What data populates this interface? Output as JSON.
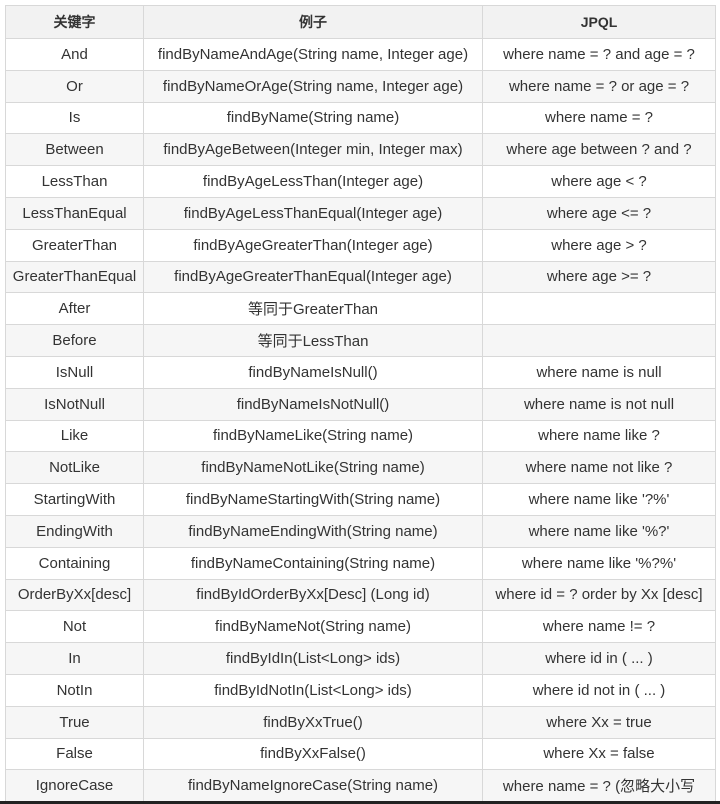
{
  "headers": [
    "关键字",
    "例子",
    "JPQL"
  ],
  "rows": [
    [
      "And",
      "findByNameAndAge(String name, Integer age)",
      "where name = ? and age = ?"
    ],
    [
      "Or",
      "findByNameOrAge(String name, Integer age)",
      "where name = ? or age = ?"
    ],
    [
      "Is",
      "findByName(String name)",
      "where name = ?"
    ],
    [
      "Between",
      "findByAgeBetween(Integer min, Integer max)",
      "where age between ? and ?"
    ],
    [
      "LessThan",
      "findByAgeLessThan(Integer age)",
      "where age < ?"
    ],
    [
      "LessThanEqual",
      "findByAgeLessThanEqual(Integer age)",
      "where age <= ?"
    ],
    [
      "GreaterThan",
      "findByAgeGreaterThan(Integer age)",
      "where age > ?"
    ],
    [
      "GreaterThanEqual",
      "findByAgeGreaterThanEqual(Integer age)",
      "where age >= ?"
    ],
    [
      "After",
      "等同于GreaterThan",
      ""
    ],
    [
      "Before",
      "等同于LessThan",
      ""
    ],
    [
      "IsNull",
      "findByNameIsNull()",
      "where name is null"
    ],
    [
      "IsNotNull",
      "findByNameIsNotNull()",
      "where name is not null"
    ],
    [
      "Like",
      "findByNameLike(String name)",
      "where name like ?"
    ],
    [
      "NotLike",
      "findByNameNotLike(String name)",
      "where name not like ?"
    ],
    [
      "StartingWith",
      "findByNameStartingWith(String name)",
      "where name like '?%'"
    ],
    [
      "EndingWith",
      "findByNameEndingWith(String name)",
      "where name like '%?'"
    ],
    [
      "Containing",
      "findByNameContaining(String name)",
      "where name like '%?%'"
    ],
    [
      "OrderByXx[desc]",
      "findByIdOrderByXx[Desc] (Long id)",
      "where id = ? order by Xx [desc]"
    ],
    [
      "Not",
      "findByNameNot(String name)",
      "where name != ?"
    ],
    [
      "In",
      "findByIdIn(List<Long> ids)",
      "where id in ( ... )"
    ],
    [
      "NotIn",
      "findByIdNotIn(List<Long> ids)",
      "where id not in ( ... )"
    ],
    [
      "True",
      "findByXxTrue()",
      "where Xx = true"
    ],
    [
      "False",
      "findByXxFalse()",
      "where Xx = false"
    ],
    [
      "IgnoreCase",
      "findByNameIgnoreCase(String name)",
      "where name = ? (忽略大小写"
    ]
  ]
}
